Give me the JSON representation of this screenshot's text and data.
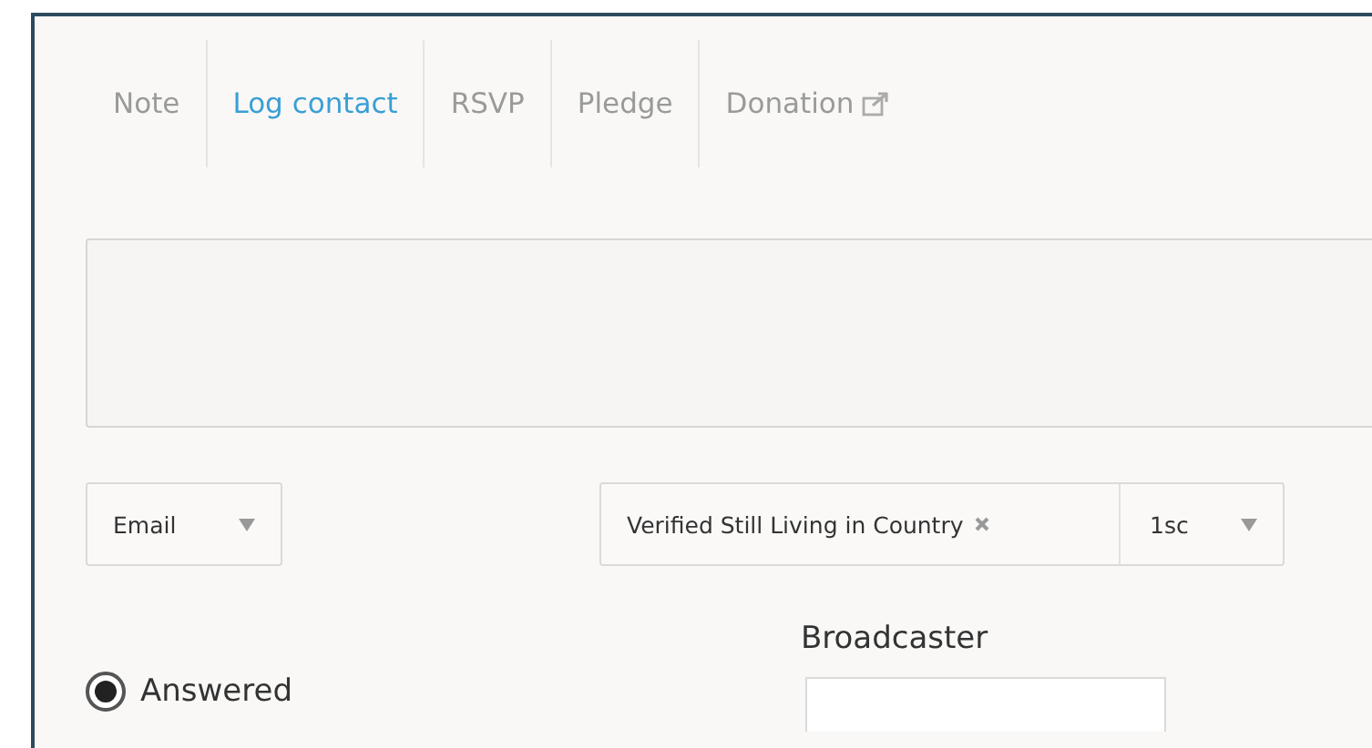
{
  "tabs": [
    {
      "label": "Note",
      "selected": false,
      "external": false
    },
    {
      "label": "Log contact",
      "selected": true,
      "external": false
    },
    {
      "label": "RSVP",
      "selected": false,
      "external": false
    },
    {
      "label": "Pledge",
      "selected": false,
      "external": false
    },
    {
      "label": "Donation",
      "selected": false,
      "external": true
    }
  ],
  "method_select": {
    "value": "Email"
  },
  "tag_select": {
    "tags": [
      "Verified Still Living in Country"
    ],
    "value": "1sc"
  },
  "status_options": [
    {
      "label": "Answered",
      "selected": true
    }
  ],
  "broadcaster": {
    "label": "Broadcaster"
  }
}
